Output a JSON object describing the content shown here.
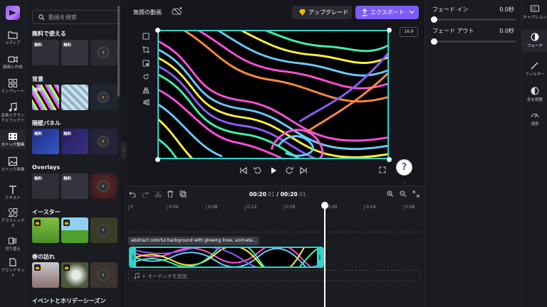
{
  "left_nav": {
    "items": [
      {
        "label": "メディア",
        "icon": "folder-icon"
      },
      {
        "label": "録画と作成",
        "icon": "camera-icon"
      },
      {
        "label": "テンプレート",
        "icon": "template-icon"
      },
      {
        "label": "音楽とサウンドエフェクト",
        "icon": "music-note-icon"
      },
      {
        "label": "ストック動画",
        "icon": "film-icon"
      },
      {
        "label": "ストック画像",
        "icon": "image-icon"
      },
      {
        "label": "テキスト",
        "icon": "text-icon"
      },
      {
        "label": "グラフィックス",
        "icon": "shapes-icon"
      },
      {
        "label": "切り替え",
        "icon": "transition-icon"
      },
      {
        "label": "ブランドキット",
        "icon": "brand-icon"
      }
    ],
    "active_index": 4
  },
  "library": {
    "search_placeholder": "動画を検索",
    "sections": [
      {
        "title": "無料で使える",
        "badges": [
          "無料",
          "無料"
        ]
      },
      {
        "title": "背景",
        "badges": [
          "無料",
          ""
        ]
      },
      {
        "title": "隔壁パネル",
        "badges": [
          "無料",
          "無料"
        ]
      },
      {
        "title": "Overlays",
        "badges": [
          "無料",
          "無料"
        ]
      },
      {
        "title": "イースター",
        "badges": [
          "",
          ""
        ]
      },
      {
        "title": "春の訪れ",
        "badges": [
          "",
          ""
        ]
      },
      {
        "title": "イベントとホリデーシーズン",
        "badges": []
      }
    ],
    "more_label": "›"
  },
  "topbar": {
    "project_title": "無題の動画",
    "upgrade_label": "アップグレード",
    "export_label": "エクスポート"
  },
  "preview": {
    "aspect_ratio": "16:9",
    "help_label": "?"
  },
  "timeline": {
    "current_time_main": "00:20",
    "current_time_frac": ".01",
    "separator": " / ",
    "total_time_main": "00:20",
    "total_time_frac": ".01",
    "ticks": [
      "0",
      "0:04",
      "0:08",
      "0:12",
      "0:16",
      "0:20",
      "0:24",
      "0:28"
    ],
    "clip_label": "abstract colorful background with glowing lines, animate...",
    "audio_placeholder": "+ オーディオを追加",
    "playhead_time": 20
  },
  "properties": {
    "fade_in_label": "フェード イン",
    "fade_in_value": "0.0秒",
    "fade_out_label": "フェード アウト",
    "fade_out_value": "0.0秒"
  },
  "right_rail": {
    "items": [
      {
        "label": "キャプション",
        "icon": "captions-icon"
      },
      {
        "label": "フェード",
        "icon": "fade-icon"
      },
      {
        "label": "フィルター",
        "icon": "magic-wand-icon"
      },
      {
        "label": "色を調整",
        "icon": "color-adjust-icon"
      },
      {
        "label": "速度",
        "icon": "speed-icon"
      }
    ],
    "active_index": 1
  },
  "colors": {
    "accent": "#7b5cf5",
    "selection": "#2fd3c8",
    "premium": "#f2b705"
  }
}
